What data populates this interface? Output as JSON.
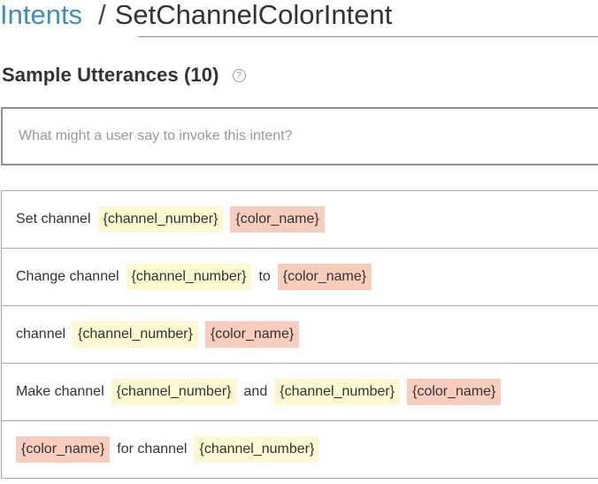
{
  "breadcrumb": {
    "parent": "Intents",
    "separator": "/",
    "current": "SetChannelColorIntent"
  },
  "section": {
    "title": "Sample Utterances (10)",
    "help_icon": "question-circle-icon"
  },
  "input": {
    "placeholder": "What might a user say to invoke this intent?",
    "value": ""
  },
  "colors": {
    "slot_channel_number": "#fef8d2",
    "slot_color_name": "#f8cdbd",
    "link": "#3b8fc9"
  },
  "utterances": [
    {
      "parts": [
        "Set channel",
        "{channel_number}",
        "{color_name}"
      ]
    },
    {
      "parts": [
        "Change channel",
        "{channel_number}",
        "to",
        "{color_name}"
      ]
    },
    {
      "parts": [
        "channel",
        "{channel_number}",
        "{color_name}"
      ]
    },
    {
      "parts": [
        "Make channel",
        "{channel_number}",
        "and",
        "{channel_number}",
        "{color_name}"
      ]
    },
    {
      "parts": [
        "{color_name}",
        "for channel",
        "{channel_number}"
      ]
    }
  ]
}
